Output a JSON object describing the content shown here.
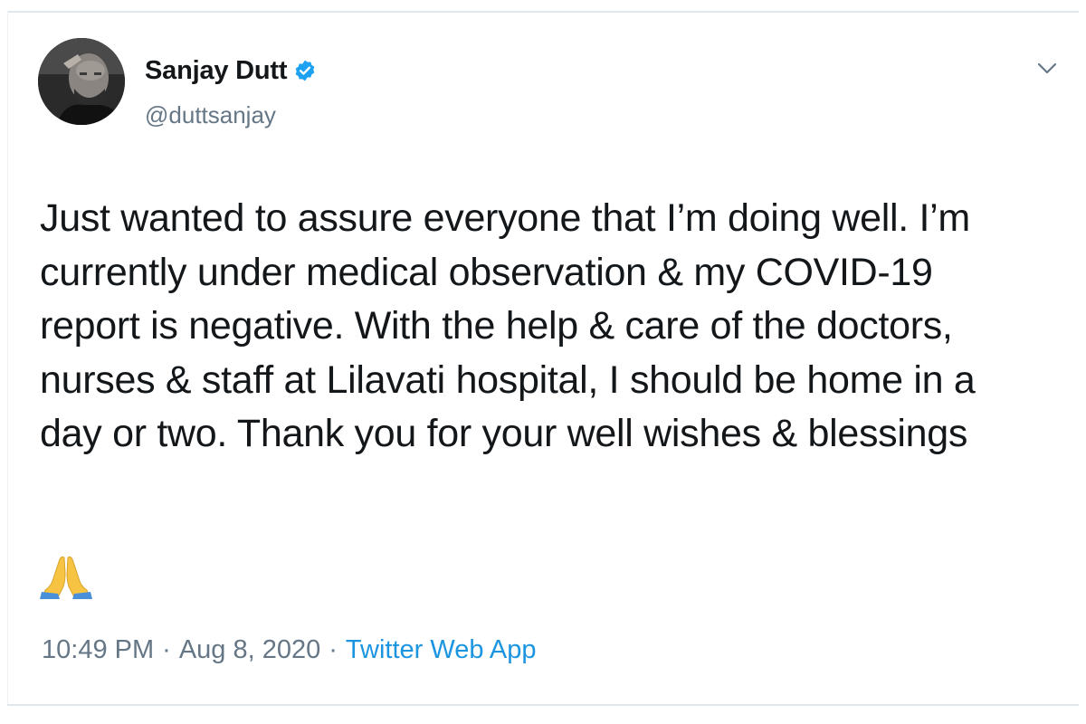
{
  "author": {
    "display_name": "Sanjay Dutt",
    "handle": "@duttsanjay",
    "verified": true,
    "verified_color": "#1da1f2"
  },
  "tweet": {
    "lines": [
      "Just wanted to assure everyone that I’m doing well. I’m",
      "currently under medical observation & my COVID-19",
      "report is negative. With the help & care of the doctors,",
      "nurses & staff at Lilavati hospital, I should be home in a",
      "day or two. Thank you for your well wishes & blessings"
    ],
    "emoji": "folded-hands"
  },
  "meta": {
    "time": "10:49 PM",
    "separator": "·",
    "date": "Aug 8, 2020",
    "source": "Twitter Web App"
  },
  "icons": {
    "menu": "chevron-down-icon",
    "verified": "verified-badge-icon"
  },
  "colors": {
    "text": "#14171a",
    "secondary": "#657786",
    "link": "#1b95e0"
  }
}
